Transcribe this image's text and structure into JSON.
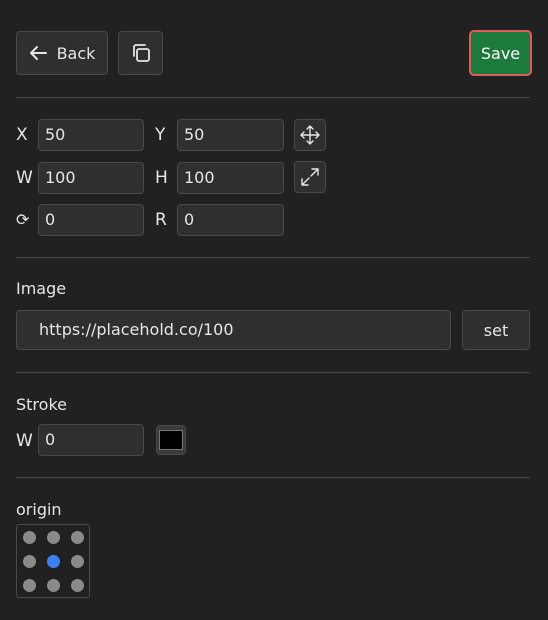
{
  "toolbar": {
    "back_label": "Back",
    "save_label": "Save"
  },
  "transform": {
    "x_label": "X",
    "x_value": "50",
    "y_label": "Y",
    "y_value": "50",
    "w_label": "W",
    "w_value": "100",
    "h_label": "H",
    "h_value": "100",
    "rotate_label": "⟳",
    "rotate_value": "0",
    "r_label": "R",
    "r_value": "0"
  },
  "image": {
    "title": "Image",
    "url": "https://placehold.co/100",
    "set_label": "set"
  },
  "stroke": {
    "title": "Stroke",
    "w_label": "W",
    "w_value": "0",
    "color": "#000000"
  },
  "origin": {
    "title": "origin",
    "selected": "center"
  },
  "colors": {
    "background": "#212121",
    "save_button": "#1d7a3d",
    "save_border": "#e05a5a",
    "origin_active": "#3b82f6"
  }
}
